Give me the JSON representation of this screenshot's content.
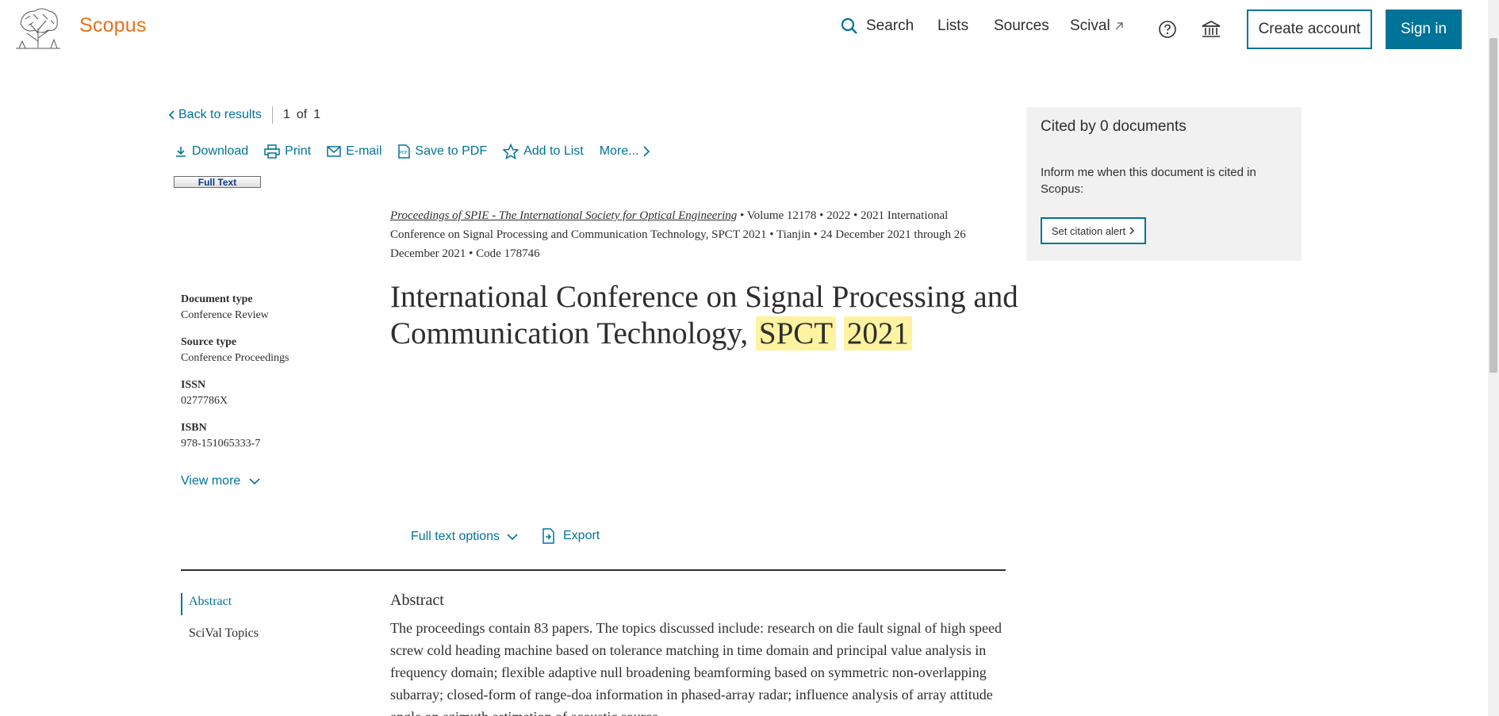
{
  "header": {
    "brand": "Scopus",
    "nav": {
      "search": "Search",
      "lists": "Lists",
      "sources": "Sources",
      "scival": "Scival",
      "scival_icon": "external-link-icon",
      "help_icon": "help-circle-icon",
      "institution_icon": "institution-icon"
    },
    "create_account": "Create account",
    "sign_in": "Sign in"
  },
  "toolbar": {
    "back": "Back to results",
    "page_current": "1",
    "page_of": "of",
    "page_total": "1",
    "download": "Download",
    "print": "Print",
    "email": "E-mail",
    "save_pdf": "Save to PDF",
    "add_list": "Add to List",
    "more": "More..."
  },
  "full_text_button": "Full Text",
  "source": {
    "journal": "Proceedings of SPIE - The International Society for Optical Engineering",
    "volume": "Volume 12178",
    "year": "2022",
    "conference": "2021 International Conference on Signal Processing and Communication Technology, SPCT 2021",
    "location": "Tianjin",
    "dates": "24 December 2021 through 26 December 2021",
    "code": "Code 178746"
  },
  "title": {
    "main": "International Conference on Signal Processing and Communication Technology,",
    "hl1": "SPCT",
    "hl2": "2021"
  },
  "meta": {
    "doc_type_label": "Document type",
    "doc_type": "Conference Review",
    "source_type_label": "Source type",
    "source_type": "Conference Proceedings",
    "issn_label": "ISSN",
    "issn": "0277786X",
    "isbn_label": "ISBN",
    "isbn": "978-151065333-7",
    "view_more": "View more"
  },
  "actions": {
    "full_text_options": "Full text options",
    "export": "Export"
  },
  "sidenav": {
    "abstract": "Abstract",
    "scival_topics": "SciVal Topics"
  },
  "abstract": {
    "heading": "Abstract",
    "text": "The proceedings contain 83 papers. The topics discussed include: research on die fault signal of high speed screw cold heading machine based on tolerance matching in time domain and principal value analysis in frequency domain; flexible adaptive null broadening beamforming based on symmetric non-overlapping subarray; closed-form of range-doa information in phased-array radar; influence analysis of array attitude angle on azimuth estimation of acoustic source"
  },
  "cited": {
    "title": "Cited by 0 documents",
    "inform": "Inform me when this document is cited in Scopus:",
    "alert_button": "Set citation alert"
  },
  "colors": {
    "brand": "#e9711c",
    "link": "#007398",
    "highlight": "#fdf3a0"
  }
}
